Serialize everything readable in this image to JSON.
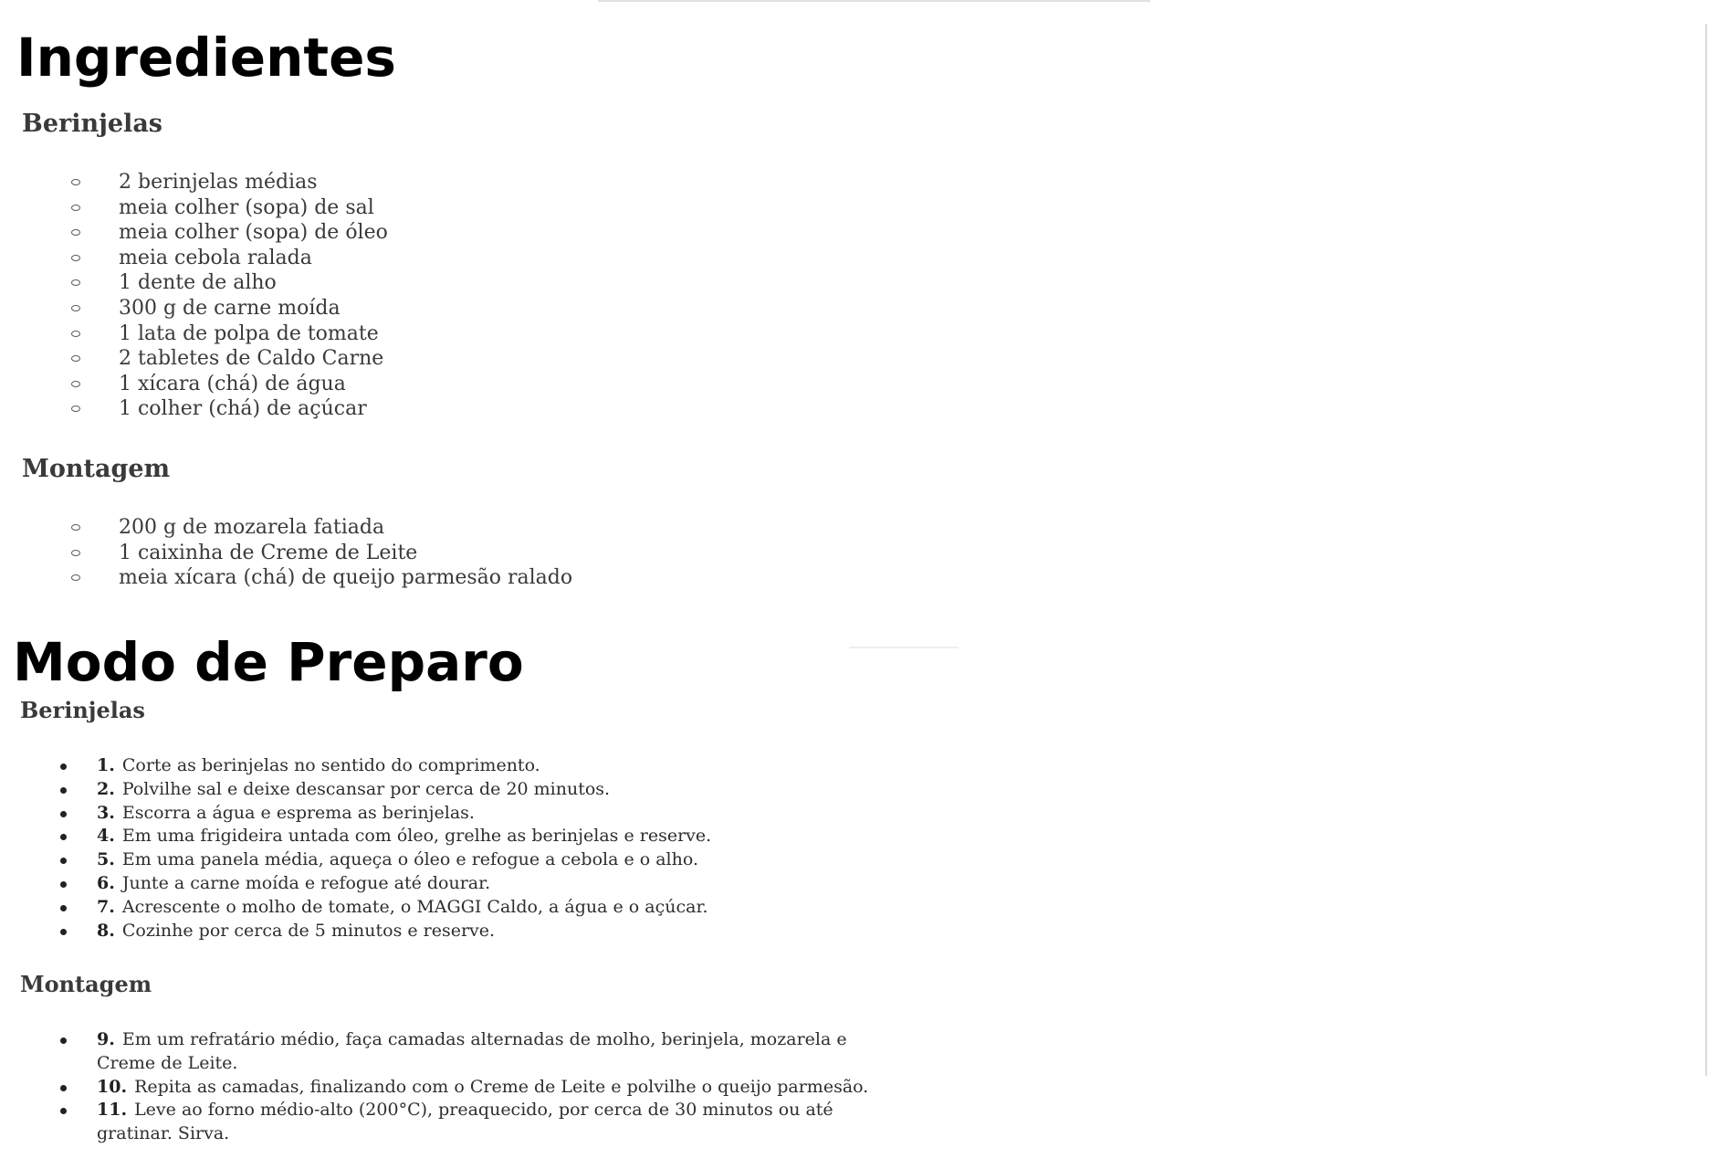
{
  "ingredientes": {
    "title": "Ingredientes",
    "berinjelas": {
      "heading": "Berinjelas",
      "items": [
        "2 berinjelas médias",
        "meia colher (sopa) de sal",
        "meia colher (sopa) de óleo",
        "meia cebola ralada",
        "1 dente de alho",
        "300 g de carne moída",
        "1 lata de polpa de tomate",
        "2 tabletes de  Caldo Carne",
        "1 xícara (chá) de água",
        "1 colher (chá) de açúcar"
      ]
    },
    "montagem": {
      "heading": "Montagem",
      "items": [
        "200 g de mozarela fatiada",
        "1 caixinha de  Creme de Leite",
        "meia xícara (chá) de queijo parmesão ralado"
      ]
    }
  },
  "preparo": {
    "title": "Modo de Preparo",
    "berinjelas": {
      "heading": "Berinjelas",
      "steps": [
        {
          "num": "1.",
          "text": "Corte as berinjelas no sentido do comprimento."
        },
        {
          "num": "2.",
          "text": "Polvilhe sal e deixe descansar por cerca de 20 minutos."
        },
        {
          "num": "3.",
          "text": "Escorra a água e esprema as berinjelas."
        },
        {
          "num": "4.",
          "text": "Em uma frigideira untada com óleo, grelhe as berinjelas e reserve."
        },
        {
          "num": "5.",
          "text": "Em uma panela média, aqueça o óleo e refogue a cebola e o alho."
        },
        {
          "num": "6.",
          "text": "Junte a carne moída e refogue até dourar."
        },
        {
          "num": "7.",
          "text": "Acrescente o molho de tomate, o MAGGI Caldo, a água e o açúcar."
        },
        {
          "num": "8.",
          "text": "Cozinhe por cerca de 5 minutos e reserve."
        }
      ]
    },
    "montagem": {
      "heading": "Montagem",
      "steps": [
        {
          "num": "9.",
          "text": "Em um refratário médio, faça camadas alternadas de molho, berinjela, mozarela e",
          "cont": "Creme de Leite."
        },
        {
          "num": "10.",
          "text": "Repita as camadas, finalizando com o Creme de Leite e polvilhe o queijo parmesão."
        },
        {
          "num": "11.",
          "text": "Leve ao forno médio-alto (200°C), preaquecido, por cerca de 30 minutos ou até",
          "cont": "gratinar. Sirva."
        }
      ]
    }
  }
}
